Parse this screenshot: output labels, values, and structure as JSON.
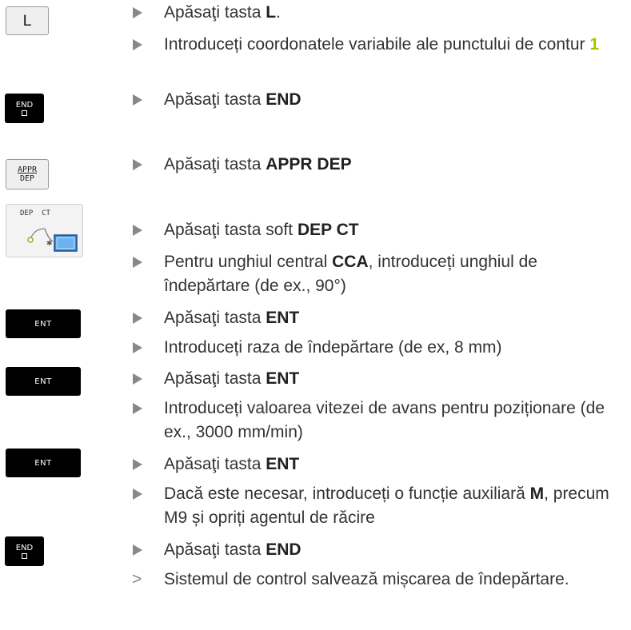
{
  "keys": {
    "l_key": "L",
    "end_label": "END",
    "appr_label": "APPR",
    "dep_label": "DEP",
    "softkey_label": "DEP  CT",
    "ent_label": "ENT"
  },
  "steps": {
    "s1": {
      "pre": "Apăsaţi tasta ",
      "bold": "L",
      "post": "."
    },
    "s2": {
      "pre": "Introduceți coordonatele variabile ale punctului de contur ",
      "hl": "1"
    },
    "s3": {
      "pre": "Apăsaţi tasta ",
      "bold": "END"
    },
    "s4": {
      "pre": "Apăsaţi tasta ",
      "bold": "APPR DEP"
    },
    "s5": {
      "pre": "Apăsaţi tasta soft ",
      "bold": "DEP CT"
    },
    "s6": {
      "pre": "Pentru unghiul central ",
      "bold": "CCA",
      "post": ", introduceți unghiul de îndepărtare (de ex., 90°)"
    },
    "s7": {
      "pre": "Apăsaţi tasta ",
      "bold": "ENT"
    },
    "s8": {
      "pre": "Introduceți raza de îndepărtare (de ex, 8 mm)"
    },
    "s9": {
      "pre": "Apăsaţi tasta ",
      "bold": "ENT"
    },
    "s10": {
      "pre": "Introduceți valoarea vitezei de avans pentru poziționare (de ex., 3000 mm/min)"
    },
    "s11": {
      "pre": "Apăsaţi tasta ",
      "bold": "ENT"
    },
    "s12": {
      "pre": "Dacă este necesar, introduceți o funcție auxiliară ",
      "bold": "M",
      "post": ", precum M9 și opriți agentul de răcire"
    },
    "s13": {
      "pre": "Apăsaţi tasta ",
      "bold": "END"
    },
    "result": {
      "arrow": ">",
      "text": "Sistemul de control salvează mișcarea de îndepărtare."
    }
  },
  "colors": {
    "highlight": "#a8c400",
    "bullet": "#888888",
    "text": "#333333"
  }
}
